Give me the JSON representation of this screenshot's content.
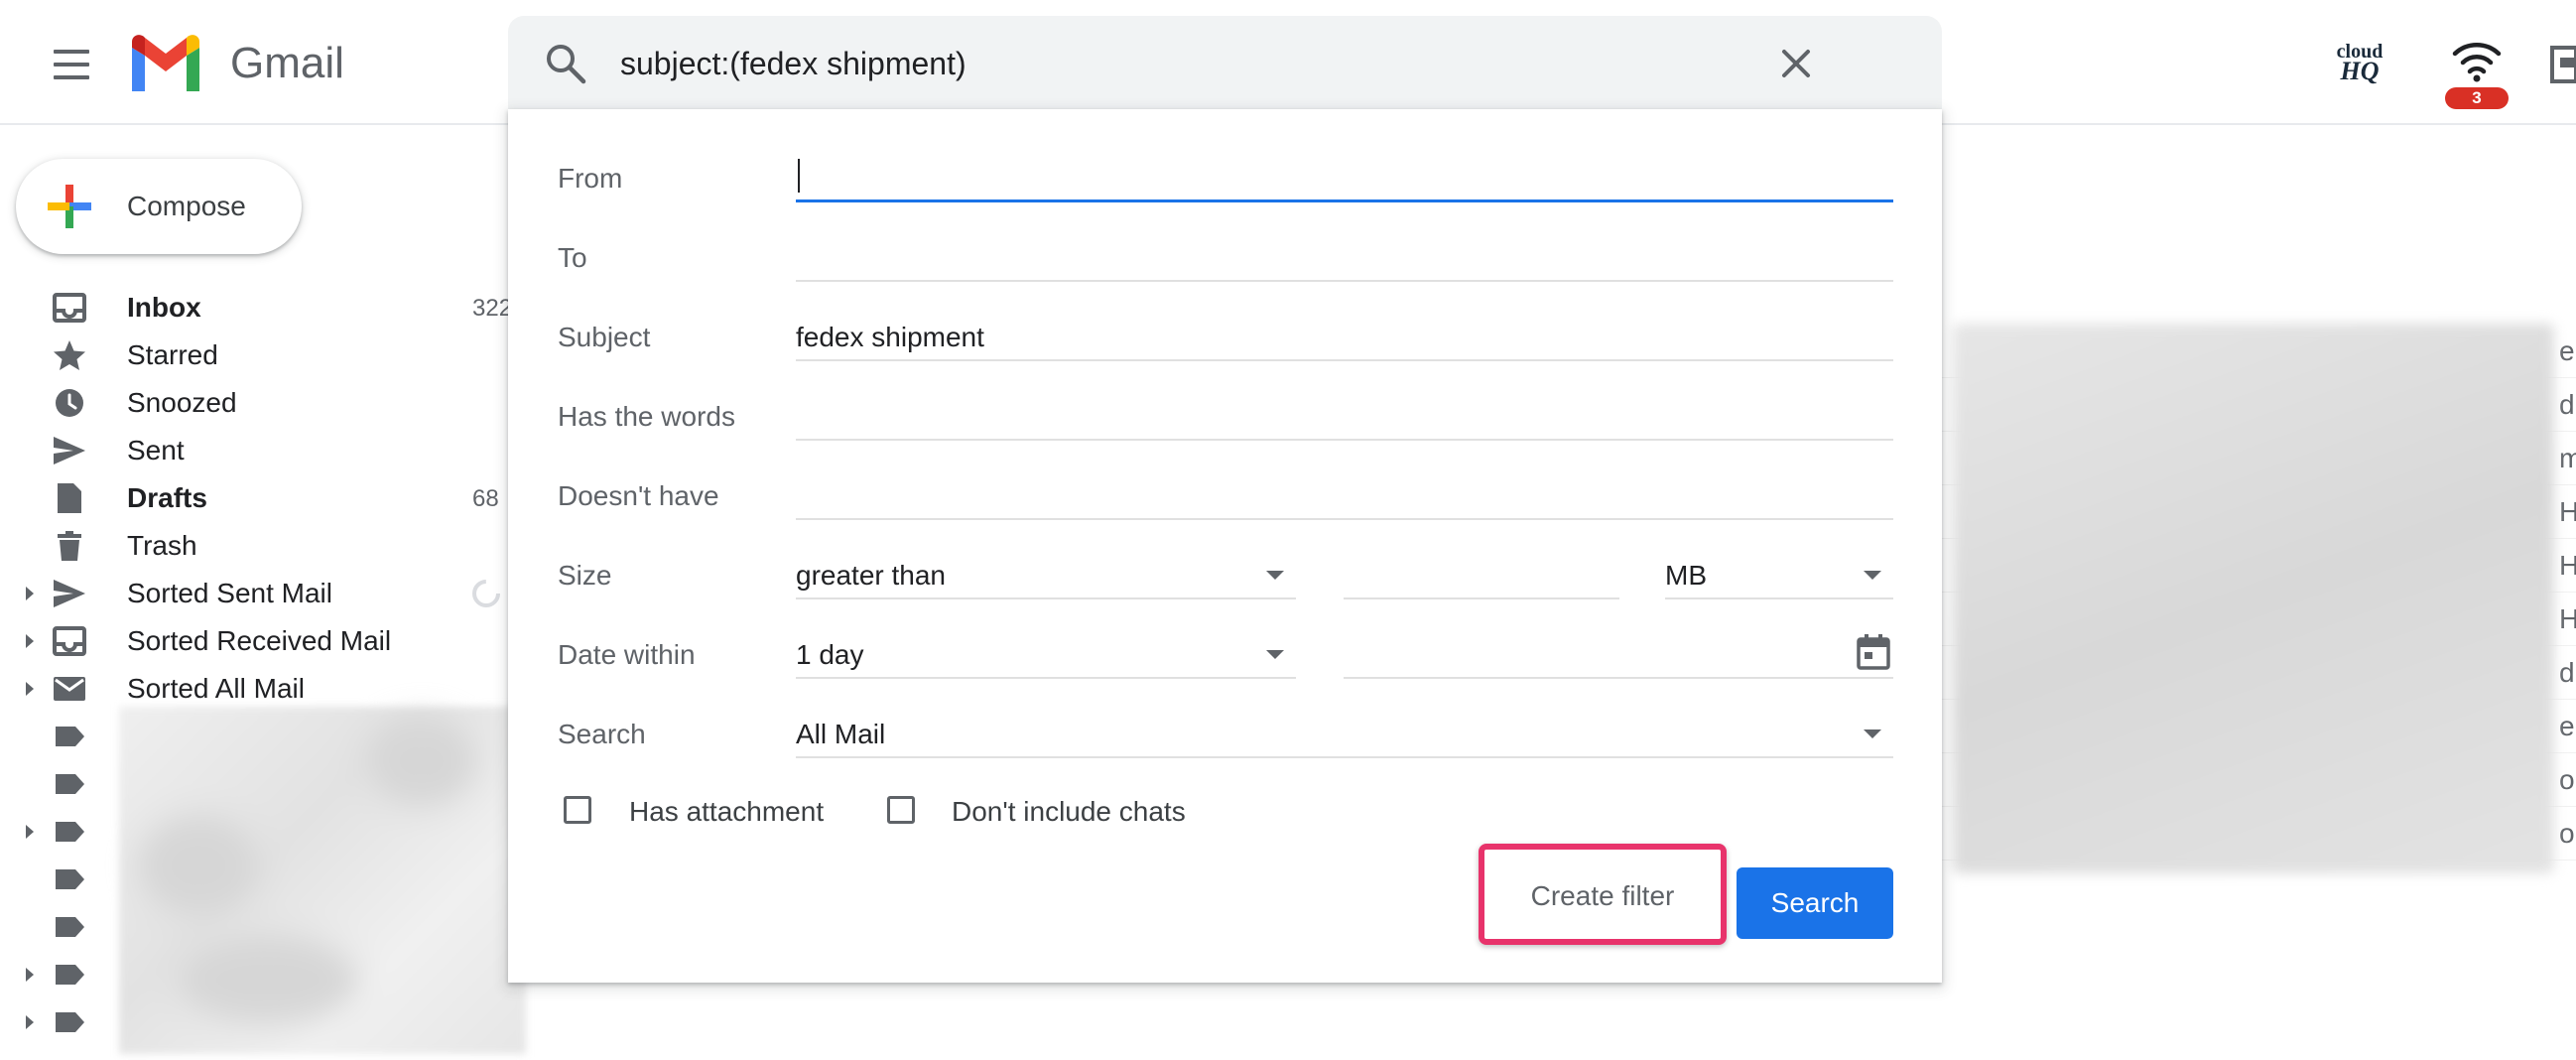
{
  "app": {
    "name": "Gmail"
  },
  "search": {
    "query": "subject:(fedex shipment)"
  },
  "header": {
    "cloudhq_line1": "cloud",
    "cloudhq_line2": "HQ",
    "notification_count": "3"
  },
  "compose": {
    "label": "Compose"
  },
  "sidebar": {
    "items": [
      {
        "label": "Inbox",
        "count": "322",
        "icon": "inbox-icon",
        "bold": true
      },
      {
        "label": "Starred",
        "count": "",
        "icon": "star-icon"
      },
      {
        "label": "Snoozed",
        "count": "",
        "icon": "clock-icon"
      },
      {
        "label": "Sent",
        "count": "",
        "icon": "send-icon"
      },
      {
        "label": "Drafts",
        "count": "68",
        "icon": "draft-icon",
        "bold": true
      },
      {
        "label": "Trash",
        "count": "",
        "icon": "trash-icon"
      },
      {
        "label": "Sorted Sent Mail",
        "count": "",
        "icon": "send-icon",
        "expandable": true
      },
      {
        "label": "Sorted Received Mail",
        "count": "",
        "icon": "inbox-icon",
        "expandable": true
      },
      {
        "label": "Sorted All Mail",
        "count": "",
        "icon": "mail-icon",
        "expandable": true
      }
    ]
  },
  "filter": {
    "from_label": "From",
    "from_value": "",
    "to_label": "To",
    "to_value": "",
    "subject_label": "Subject",
    "subject_value": "fedex shipment",
    "has_words_label": "Has the words",
    "has_words_value": "",
    "doesnt_have_label": "Doesn't have",
    "doesnt_have_value": "",
    "size_label": "Size",
    "size_operator": "greater than",
    "size_value": "",
    "size_unit": "MB",
    "date_within_label": "Date within",
    "date_within_value": "1 day",
    "date_value": "",
    "search_label": "Search",
    "search_scope": "All Mail",
    "has_attachment_label": "Has attachment",
    "has_attachment_checked": false,
    "dont_include_chats_label": "Don't include chats",
    "dont_include_chats_checked": false,
    "create_filter_label": "Create filter",
    "search_button_label": "Search"
  },
  "colors": {
    "accent": "#1a73e8",
    "highlight": "#e8336b",
    "badge": "#d93025"
  }
}
